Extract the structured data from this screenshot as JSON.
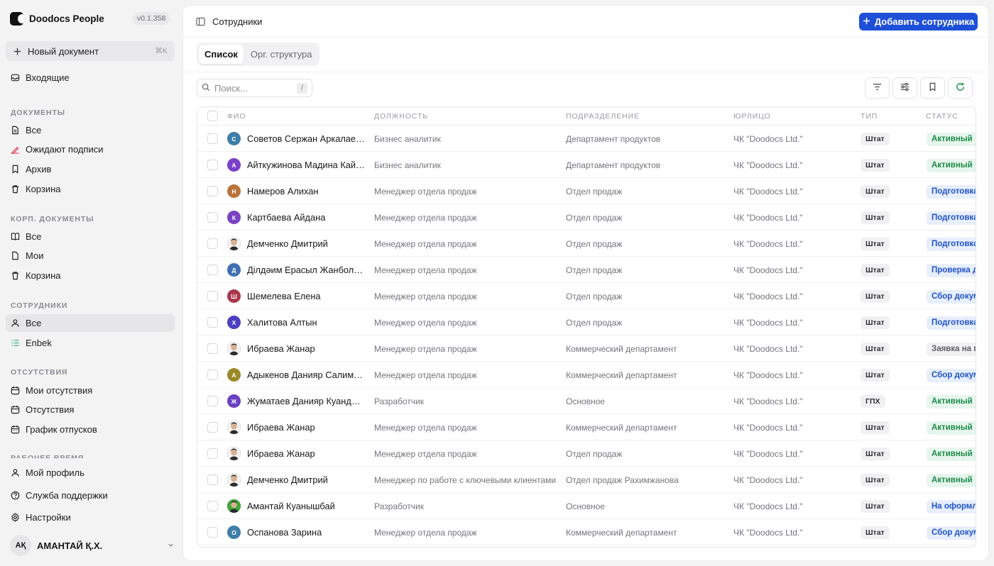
{
  "app": {
    "name": "Doodocs People",
    "version": "v0.1.358"
  },
  "sidebar": {
    "new_doc": {
      "label": "Новый документ",
      "shortcut": "⌘K"
    },
    "inbox": "Входящие",
    "sections": {
      "docs": {
        "title": "ДОКУМЕНТЫ",
        "items": [
          "Все",
          "Ожидают подписи",
          "Архив",
          "Корзина"
        ]
      },
      "corp": {
        "title": "КОРП. ДОКУМЕНТЫ",
        "items": [
          "Все",
          "Мои",
          "Корзина"
        ]
      },
      "staff": {
        "title": "СОТРУДНИКИ",
        "items": [
          "Все",
          "Enbek"
        ]
      },
      "absence": {
        "title": "ОТСУТСТВИЯ",
        "items": [
          "Мои отсутствия",
          "Отсутствия",
          "График отпусков"
        ]
      },
      "worktime": {
        "title": "РАБОЧЕЕ ВРЕМЯ"
      }
    },
    "bottom": [
      "Мой профиль",
      "Служба поддержки",
      "Настройки"
    ],
    "user": {
      "initials": "АҚ",
      "name": "АМАНТАЙ Қ.Х."
    }
  },
  "header": {
    "title": "Сотрудники",
    "add_button": "Добавить сотрудника"
  },
  "tabs": [
    "Список",
    "Орг. структура"
  ],
  "search": {
    "placeholder": "Поиск...",
    "shortcut": "/"
  },
  "table": {
    "columns": [
      "ФИО",
      "ДОЛЖНОСТЬ",
      "ПОДРАЗДЕЛЕНИЕ",
      "ЮРЛИЦО",
      "ТИП",
      "СТАТУС"
    ],
    "rows": [
      {
        "initial": "С",
        "avatar_color": "#3d7fa8",
        "name": "Советов Сержан Аркалаевич",
        "position": "Бизнес аналитик",
        "dept": "Департамент продуктов",
        "org": "ЧК \"Doodocs Ltd.\"",
        "type": "Штат",
        "status": "Активный",
        "status_kind": "green"
      },
      {
        "initial": "А",
        "avatar_color": "#7a3fc9",
        "name": "Айткужинова Мадина Кайратовна",
        "position": "Бизнес аналитик",
        "dept": "Департамент продуктов",
        "org": "ЧК \"Doodocs Ltd.\"",
        "type": "Штат",
        "status": "Активный",
        "status_kind": "green"
      },
      {
        "initial": "Н",
        "avatar_color": "#b8733a",
        "name": "Намеров Алихан",
        "position": "Менеджер отдела продаж",
        "dept": "Отдел продаж",
        "org": "ЧК \"Doodocs Ltd.\"",
        "type": "Штат",
        "status": "Подготовка",
        "status_kind": "blue"
      },
      {
        "initial": "К",
        "avatar_color": "#7b42c4",
        "name": "Картбаева Айдана",
        "position": "Менеджер отдела продаж",
        "dept": "Отдел продаж",
        "org": "ЧК \"Doodocs Ltd.\"",
        "type": "Штат",
        "status": "Подготовка",
        "status_kind": "blue"
      },
      {
        "initial": "",
        "avatar_color": "photo",
        "name": "Демченко Дмитрий",
        "position": "Менеджер отдела продаж",
        "dept": "Отдел продаж",
        "org": "ЧК \"Doodocs Ltd.\"",
        "type": "Штат",
        "status": "Подготовка",
        "status_kind": "blue"
      },
      {
        "initial": "Д",
        "avatar_color": "#3f6fb0",
        "name": "Ділдәим Ерасыл Жанболатұлы",
        "position": "Менеджер отдела продаж",
        "dept": "Отдел продаж",
        "org": "ЧК \"Doodocs Ltd.\"",
        "type": "Штат",
        "status": "Проверка д",
        "status_kind": "blue"
      },
      {
        "initial": "Ш",
        "avatar_color": "#a8384d",
        "name": "Шемелева Елена",
        "position": "Менеджер отдела продаж",
        "dept": "Отдел продаж",
        "org": "ЧК \"Doodocs Ltd.\"",
        "type": "Штат",
        "status": "Сбор докум",
        "status_kind": "blue"
      },
      {
        "initial": "Х",
        "avatar_color": "#4b3fc0",
        "name": "Халитова Алтын",
        "position": "Менеджер отдела продаж",
        "dept": "Отдел продаж",
        "org": "ЧК \"Doodocs Ltd.\"",
        "type": "Штат",
        "status": "Подготовка",
        "status_kind": "blue"
      },
      {
        "initial": "",
        "avatar_color": "photo",
        "name": "Ибраева Жанар",
        "position": "Менеджер отдела продаж",
        "dept": "Коммерческий департамент",
        "org": "ЧК \"Doodocs Ltd.\"",
        "type": "Штат",
        "status": "Заявка на п",
        "status_kind": "grey"
      },
      {
        "initial": "А",
        "avatar_color": "#9a8a2a",
        "name": "Адыкенов Данияр Салимжанович",
        "position": "Менеджер отдела продаж",
        "dept": "Коммерческий департамент",
        "org": "ЧК \"Doodocs Ltd.\"",
        "type": "Штат",
        "status": "Сбор докум",
        "status_kind": "blue"
      },
      {
        "initial": "Ж",
        "avatar_color": "#6b3fc4",
        "name": "Жуматаев Данияр Куандыкович",
        "position": "Разработчик",
        "dept": "Основное",
        "org": "ЧК \"Doodocs Ltd.\"",
        "type": "ГПХ",
        "status": "Активный",
        "status_kind": "green"
      },
      {
        "initial": "",
        "avatar_color": "photo",
        "name": "Ибраева Жанар",
        "position": "Менеджер отдела продаж",
        "dept": "Коммерческий департамент",
        "org": "ЧК \"Doodocs Ltd.\"",
        "type": "Штат",
        "status": "Активный",
        "status_kind": "green"
      },
      {
        "initial": "",
        "avatar_color": "photo",
        "name": "Ибраева Жанар",
        "position": "Менеджер отдела продаж",
        "dept": "Отдел продаж",
        "org": "ЧК \"Doodocs Ltd.\"",
        "type": "Штат",
        "status": "Активный",
        "status_kind": "green"
      },
      {
        "initial": "",
        "avatar_color": "photo",
        "name": "Демченко Дмитрий",
        "position": "Менеджер по работе с ключевыми клиентами",
        "dept": "Отдел продаж Рахимжанова",
        "org": "ЧК \"Doodocs Ltd.\"",
        "type": "Штат",
        "status": "Активный",
        "status_kind": "green"
      },
      {
        "initial": "",
        "avatar_color": "photo-green",
        "name": "Амантай Куанышбай",
        "position": "Разработчик",
        "dept": "Основное",
        "org": "ЧК \"Doodocs Ltd.\"",
        "type": "Штат",
        "status": "На оформл",
        "status_kind": "blue"
      },
      {
        "initial": "О",
        "avatar_color": "#3d7fa8",
        "name": "Оспанова Зарина",
        "position": "Менеджер отдела продаж",
        "dept": "Коммерческий департамент",
        "org": "ЧК \"Doodocs Ltd.\"",
        "type": "Штат",
        "status": "Сбор докум",
        "status_kind": "blue"
      }
    ]
  }
}
